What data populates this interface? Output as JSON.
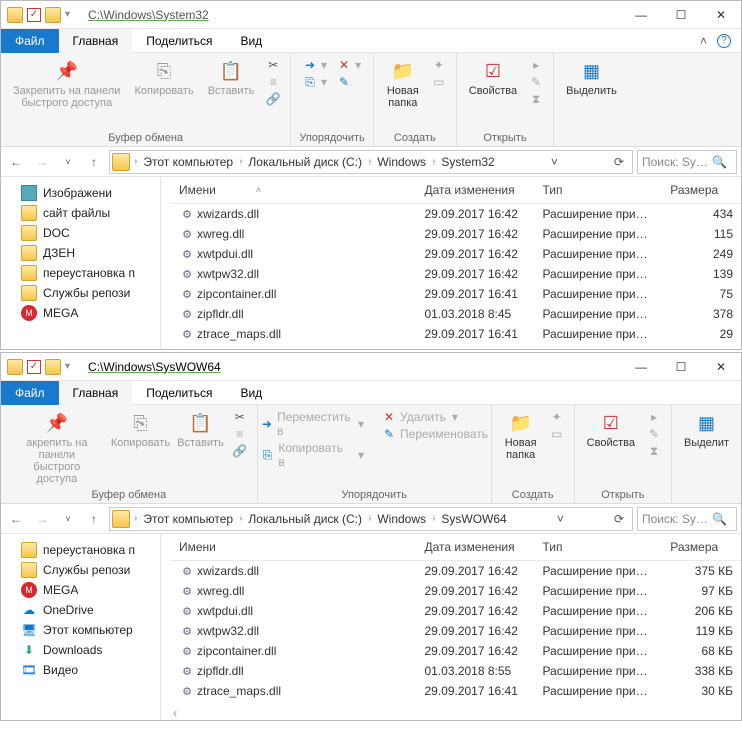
{
  "win1": {
    "path": "C:\\Windows\\System32",
    "tabs": {
      "file": "Файл",
      "home": "Главная",
      "share": "Поделиться",
      "view": "Вид"
    },
    "ribbon": {
      "pin": "Закрепить на панели\nбыстрого доступа",
      "copy": "Копировать",
      "paste": "Вставить",
      "clipboard": "Буфер обмена",
      "organize": "Упорядочить",
      "newfolder": "Новая\nпапка",
      "create": "Создать",
      "properties": "Свойства",
      "open": "Открыть",
      "select": "Выделить"
    },
    "breadcrumbs": [
      "Этот компьютер",
      "Локальный диск (C:)",
      "Windows",
      "System32"
    ],
    "search_placeholder": "Поиск: Sy…",
    "tree": [
      {
        "icon": "img",
        "label": "Изображени"
      },
      {
        "icon": "folder",
        "label": "сайт файлы"
      },
      {
        "icon": "folder",
        "label": "DOC"
      },
      {
        "icon": "folder",
        "label": "ДЗЕН"
      },
      {
        "icon": "folder",
        "label": "переустановка п"
      },
      {
        "icon": "folder",
        "label": "Службы репози"
      },
      {
        "icon": "mega",
        "label": "MEGA"
      }
    ],
    "cols": {
      "name": "Имени",
      "date": "Дата изменения",
      "type": "Тип",
      "size": "Размера"
    },
    "rows": [
      {
        "name": "xwizards.dll",
        "date": "29.09.2017 16:42",
        "type": "Расширение при…",
        "size": "434"
      },
      {
        "name": "xwreg.dll",
        "date": "29.09.2017 16:42",
        "type": "Расширение при…",
        "size": "115"
      },
      {
        "name": "xwtpdui.dll",
        "date": "29.09.2017 16:42",
        "type": "Расширение при…",
        "size": "249"
      },
      {
        "name": "xwtpw32.dll",
        "date": "29.09.2017 16:42",
        "type": "Расширение при…",
        "size": "139"
      },
      {
        "name": "zipcontainer.dll",
        "date": "29.09.2017 16:41",
        "type": "Расширение при…",
        "size": "75"
      },
      {
        "name": "zipfldr.dll",
        "date": "01.03.2018 8:45",
        "type": "Расширение при…",
        "size": "378"
      },
      {
        "name": "ztrace_maps.dll",
        "date": "29.09.2017 16:41",
        "type": "Расширение при…",
        "size": "29"
      }
    ]
  },
  "win2": {
    "path": "C:\\Windows\\SysWOW64",
    "tabs": {
      "file": "Файл",
      "home": "Главная",
      "share": "Поделиться",
      "view": "Вид"
    },
    "ribbon": {
      "pin": "акрепить на панели\nбыстрого доступа",
      "copy": "Копировать",
      "paste": "Вставить",
      "clipboard": "Буфер обмена",
      "moveto": "Переместить в",
      "copyto": "Копировать в",
      "delete": "Удалить",
      "rename": "Переименовать",
      "organize": "Упорядочить",
      "newfolder": "Новая\nпапка",
      "create": "Создать",
      "properties": "Свойства",
      "open": "Открыть",
      "select": "Выделит"
    },
    "breadcrumbs": [
      "Этот компьютер",
      "Локальный диск (C:)",
      "Windows",
      "SysWOW64"
    ],
    "search_placeholder": "Поиск: Sy…",
    "tree": [
      {
        "icon": "folder",
        "label": "переустановка п"
      },
      {
        "icon": "folder",
        "label": "Службы репози"
      },
      {
        "icon": "mega",
        "label": "MEGA"
      },
      {
        "icon": "onedrive",
        "label": "OneDrive"
      },
      {
        "icon": "pc",
        "label": "Этот компьютер"
      },
      {
        "icon": "dl",
        "label": "Downloads"
      },
      {
        "icon": "video",
        "label": "Видео"
      }
    ],
    "cols": {
      "name": "Имени",
      "date": "Дата изменения",
      "type": "Тип",
      "size": "Размера"
    },
    "rows": [
      {
        "name": "xwizards.dll",
        "date": "29.09.2017 16:42",
        "type": "Расширение при…",
        "size": "375 КБ"
      },
      {
        "name": "xwreg.dll",
        "date": "29.09.2017 16:42",
        "type": "Расширение при…",
        "size": "97 КБ"
      },
      {
        "name": "xwtpdui.dll",
        "date": "29.09.2017 16:42",
        "type": "Расширение при…",
        "size": "206 КБ"
      },
      {
        "name": "xwtpw32.dll",
        "date": "29.09.2017 16:42",
        "type": "Расширение при…",
        "size": "119 КБ"
      },
      {
        "name": "zipcontainer.dll",
        "date": "29.09.2017 16:42",
        "type": "Расширение при…",
        "size": "68 КБ"
      },
      {
        "name": "zipfldr.dll",
        "date": "01.03.2018 8:55",
        "type": "Расширение при…",
        "size": "338 КБ"
      },
      {
        "name": "ztrace_maps.dll",
        "date": "29.09.2017 16:41",
        "type": "Расширение при…",
        "size": "30 КБ"
      }
    ]
  }
}
